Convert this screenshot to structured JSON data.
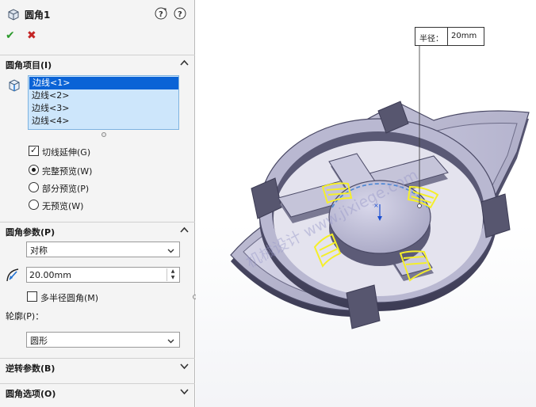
{
  "feature": {
    "title": "圆角1",
    "help_icon": "help-link-icon",
    "ok_icon": "check-icon",
    "cancel_icon": "close-icon"
  },
  "items_section": {
    "header": "圆角项目(I)",
    "edges": [
      "边线<1>",
      "边线<2>",
      "边线<3>",
      "边线<4>"
    ],
    "selected_index": 0,
    "tangent_propagation": {
      "label": "切线延伸(G)",
      "checked": true
    },
    "preview_options": [
      {
        "label": "完整预览(W)",
        "selected": true
      },
      {
        "label": "部分预览(P)",
        "selected": false
      },
      {
        "label": "无预览(W)",
        "selected": false
      }
    ]
  },
  "params_section": {
    "header": "圆角参数(P)",
    "type_value": "对称",
    "radius_value": "20.00mm",
    "multi_radius": {
      "label": "多半径圆角(M)",
      "checked": false
    },
    "profile_label": "轮廓(P)：",
    "profile_value": "圆形"
  },
  "reverse_section": {
    "header": "逆转参数(B)"
  },
  "options_section": {
    "header": "圆角选项(O)"
  },
  "callout": {
    "caption": "半径：",
    "value": "20mm"
  },
  "watermark": "机械设计  www.jixiege.com",
  "colors": {
    "accent_selection": "#0a63d6",
    "edge_highlight": "#f5ef2a",
    "model_body": "#8f8ea8"
  }
}
